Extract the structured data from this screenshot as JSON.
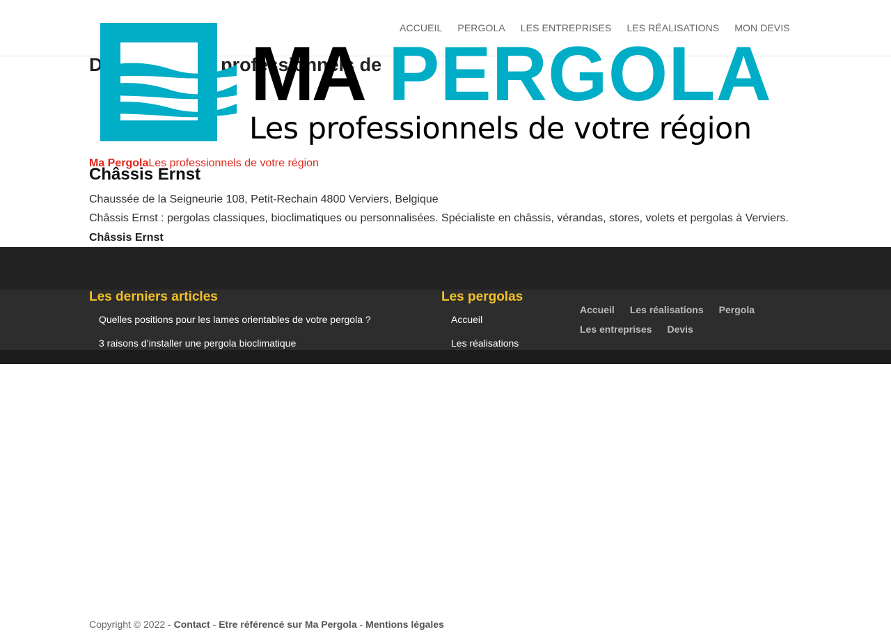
{
  "nav": {
    "items": [
      "ACCUEIL",
      "PERGOLA",
      "LES ENTREPRISES",
      "LES RÉALISATIONS",
      "MON DEVIS"
    ]
  },
  "page": {
    "title": "Découvrez les professionnels de"
  },
  "logo": {
    "ma": "MA",
    "pergola": "PERGOLA",
    "tagline": "Les professionnels de votre région",
    "brand_color": "#00adc6"
  },
  "brand_line": {
    "name": "Ma Pergola",
    "tagline": "Les professionnels de votre région"
  },
  "business": {
    "name": "Châssis Ernst",
    "address": "Chaussée de la Seigneurie 108, Petit-Rechain 4800 Verviers, Belgique",
    "description": "Châssis Ernst : pergolas classiques, bioclimatiques ou personnalisées. Spécialiste en châssis, vérandas, stores, volets et pergolas à Verviers.",
    "bold_name": "Châssis Ernst"
  },
  "footer": {
    "articles_title": "Les derniers articles",
    "articles": [
      "Quelles positions pour les lames orientables de votre pergola ?",
      "3 raisons d’installer une pergola bioclimatique"
    ],
    "pergolas_title": "Les pergolas",
    "pergolas": [
      "Accueil",
      "Les réalisations"
    ],
    "nav": [
      "Accueil",
      "Les réalisations",
      "Pergola",
      "Les entreprises",
      "Devis"
    ]
  },
  "copyright": {
    "text": "Copyright © 2022 - ",
    "contact": "Contact",
    "sep1": " - ",
    "referenced": "Etre référencé sur Ma Pergola",
    "sep2": " - ",
    "legal": "Mentions légales"
  }
}
